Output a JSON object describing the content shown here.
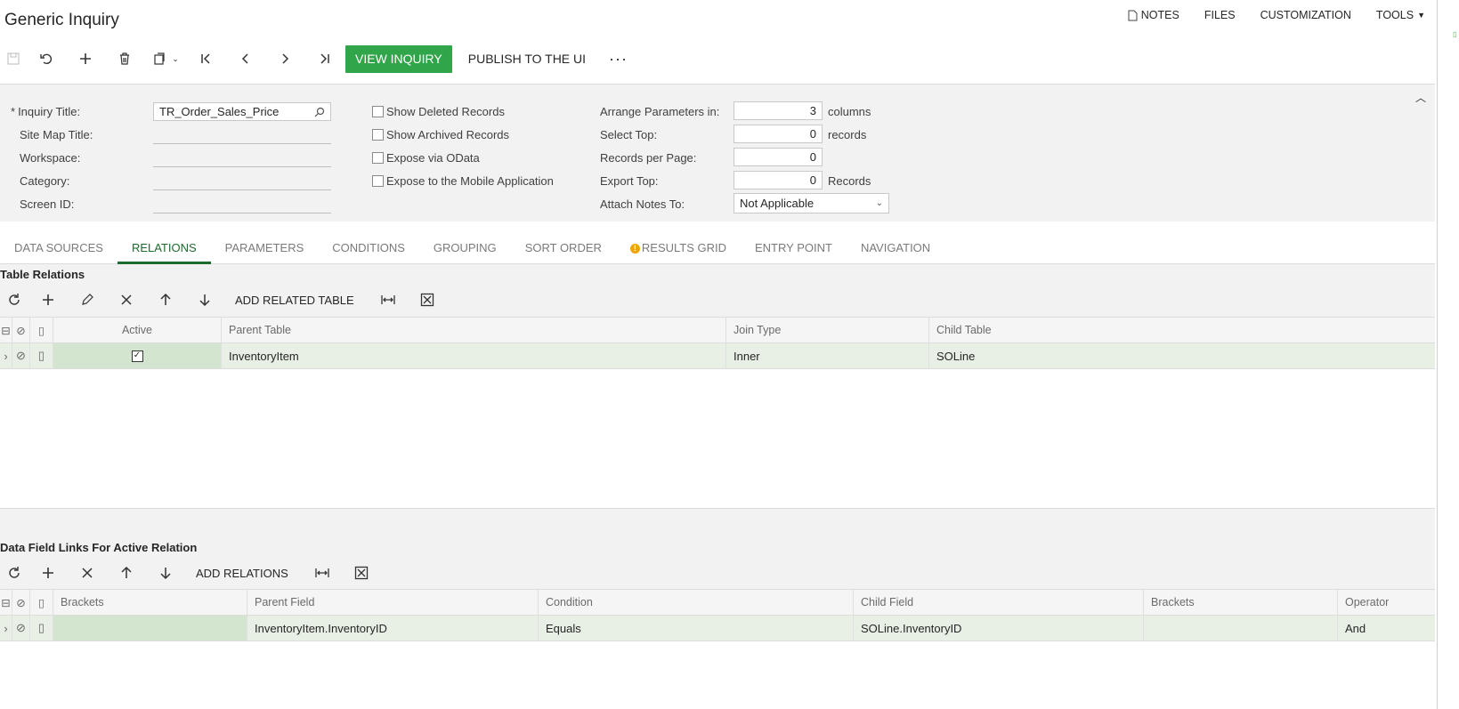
{
  "page": {
    "title": "Generic Inquiry"
  },
  "top_links": {
    "notes": "NOTES",
    "files": "FILES",
    "customization": "CUSTOMIZATION",
    "tools": "TOOLS"
  },
  "toolbar": {
    "view_inquiry": "VIEW INQUIRY",
    "publish": "PUBLISH TO THE UI",
    "more": "···",
    "icons": [
      "save-icon",
      "undo-icon",
      "add-icon",
      "delete-icon",
      "copy-paste-icon",
      "first-icon",
      "previous-icon",
      "next-icon",
      "last-icon"
    ]
  },
  "form": {
    "inquiry_title_label": "Inquiry Title:",
    "inquiry_title_value": "TR_Order_Sales_Price",
    "site_map_title_label": "Site Map Title:",
    "workspace_label": "Workspace:",
    "category_label": "Category:",
    "screen_id_label": "Screen ID:",
    "show_deleted": "Show Deleted Records",
    "show_archived": "Show Archived Records",
    "expose_odata": "Expose via OData",
    "expose_mobile": "Expose to the Mobile Application",
    "arrange_label": "Arrange Parameters in:",
    "arrange_value": "3",
    "arrange_unit": "columns",
    "select_top_label": "Select Top:",
    "select_top_value": "0",
    "select_top_unit": "records",
    "records_per_page_label": "Records per Page:",
    "records_per_page_value": "0",
    "export_top_label": "Export Top:",
    "export_top_value": "0",
    "export_top_unit": "Records",
    "attach_notes_label": "Attach Notes To:",
    "attach_notes_value": "Not Applicable"
  },
  "tabs": [
    "DATA SOURCES",
    "RELATIONS",
    "PARAMETERS",
    "CONDITIONS",
    "GROUPING",
    "SORT ORDER",
    "RESULTS GRID",
    "ENTRY POINT",
    "NAVIGATION"
  ],
  "active_tab": "RELATIONS",
  "relations": {
    "title": "Table Relations",
    "add_button": "ADD RELATED TABLE",
    "headers": {
      "active": "Active",
      "parent": "Parent Table",
      "join": "Join Type",
      "child": "Child Table"
    },
    "rows": [
      {
        "active": true,
        "parent": "InventoryItem",
        "join": "Inner",
        "child": "SOLine"
      }
    ]
  },
  "links": {
    "title": "Data Field Links For Active Relation",
    "add_button": "ADD RELATIONS",
    "headers": {
      "brackets1": "Brackets",
      "parent": "Parent Field",
      "condition": "Condition",
      "child": "Child Field",
      "brackets2": "Brackets",
      "operator": "Operator"
    },
    "rows": [
      {
        "brackets1": "",
        "parent": "InventoryItem.InventoryID",
        "condition": "Equals",
        "child": "SOLine.InventoryID",
        "brackets2": "",
        "operator": "And"
      }
    ]
  },
  "colors": {
    "primary_green": "#30a54a",
    "active_tab": "#1d6b2e",
    "row_highlight": "#e8efe4"
  }
}
